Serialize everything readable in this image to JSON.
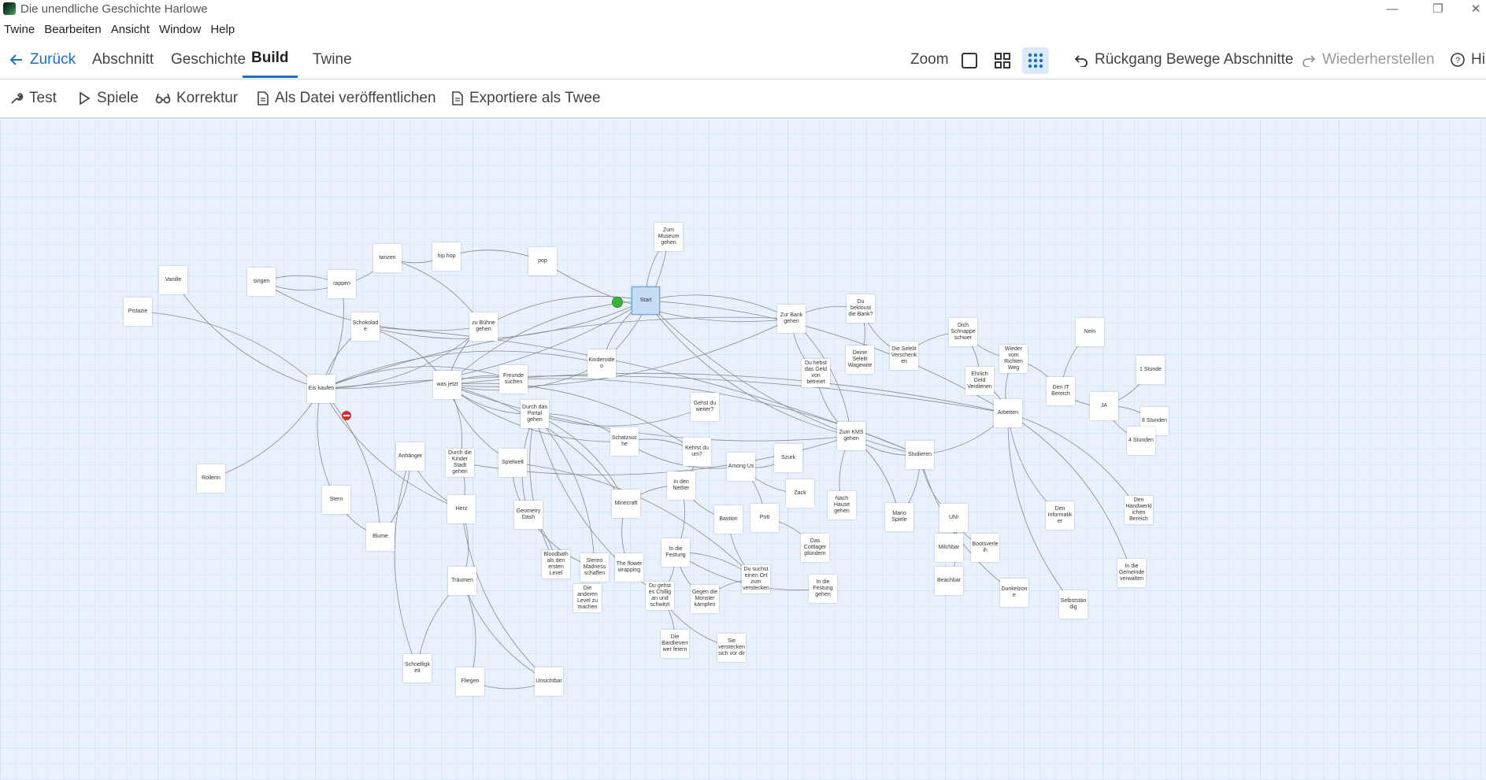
{
  "window": {
    "title": "Die unendliche Geschichte Harlowe"
  },
  "menu": [
    "Twine",
    "Bearbeiten",
    "Ansicht",
    "Window",
    "Help"
  ],
  "toolbar": {
    "back": "Zurück",
    "tabs": [
      "Abschnitt",
      "Geschichte",
      "Build",
      "Twine"
    ],
    "active_tab": "Build",
    "zoom_label": "Zoom",
    "undo": "Rückgang Bewege Abschnitte",
    "redo": "Wiederherstellen",
    "help": "Hil"
  },
  "build_toolbar": {
    "test": "Test",
    "play": "Spiele",
    "proof": "Korrektur",
    "publish": "Als Datei veröffentlichen",
    "export": "Exportiere als Twee"
  },
  "colors": {
    "accent": "#1a6fc7",
    "start": "#3cb43c",
    "broken": "#d32f2f"
  },
  "passages": [
    {
      "name": "Start"
    },
    {
      "name": "Zum Museum gehen"
    },
    {
      "name": "Vanille"
    },
    {
      "name": "Pistazie"
    },
    {
      "name": "singen"
    },
    {
      "name": "rappen"
    },
    {
      "name": "tanzen"
    },
    {
      "name": "hip hop"
    },
    {
      "name": "pop"
    },
    {
      "name": "Schokolade"
    },
    {
      "name": "zu Bühne gehen"
    },
    {
      "name": "Eis kaufen"
    },
    {
      "name": "was jetzt"
    },
    {
      "name": "Freunde suchen"
    },
    {
      "name": "Kindervideo"
    },
    {
      "name": "Zur Bank gehen"
    },
    {
      "name": "Du bekloust die Bank?"
    },
    {
      "name": "Deine Selelit Wagewite"
    },
    {
      "name": "Die Selelit Verschenken"
    },
    {
      "name": "Dich Schnappe schwer"
    },
    {
      "name": "Du hebst das Geld von betreiet"
    },
    {
      "name": "Ehrlich Geld Verdienen"
    },
    {
      "name": "Wieder vom Richten Weg"
    },
    {
      "name": "Nein"
    },
    {
      "name": "Den IT Bereich"
    },
    {
      "name": "1 Stunde"
    },
    {
      "name": "JA"
    },
    {
      "name": "8 Stunden"
    },
    {
      "name": "4 Stunden"
    },
    {
      "name": "Arbeiten"
    },
    {
      "name": "Durch das Portal gehen"
    },
    {
      "name": "Gehst du weiter?"
    },
    {
      "name": "Anhänger"
    },
    {
      "name": "Durch die Kinder Stadt gehen"
    },
    {
      "name": "Spielwelt"
    },
    {
      "name": "Schatzsuche"
    },
    {
      "name": "Kehrst du um?"
    },
    {
      "name": "Among Us"
    },
    {
      "name": "Szurk"
    },
    {
      "name": "Zum KMS gehen"
    },
    {
      "name": "Studieren"
    },
    {
      "name": "Rollerin"
    },
    {
      "name": "Stern"
    },
    {
      "name": "Herz"
    },
    {
      "name": "Blume"
    },
    {
      "name": "Geometry Dash"
    },
    {
      "name": "Minecraft"
    },
    {
      "name": "In den Nether"
    },
    {
      "name": "Zack"
    },
    {
      "name": "Nach Hause gehen"
    },
    {
      "name": "Mario Spiele"
    },
    {
      "name": "UNI"
    },
    {
      "name": "Den Informatiker"
    },
    {
      "name": "Den Handwerklichen Bereich"
    },
    {
      "name": "Bastion"
    },
    {
      "name": "Pott"
    },
    {
      "name": "Das Cottlager plündern"
    },
    {
      "name": "In die Festung"
    },
    {
      "name": "Bloodbath als den ersten Level"
    },
    {
      "name": "Stereo Madness schaffen"
    },
    {
      "name": "The flower wrapping"
    },
    {
      "name": "Du suchst einen Ort zum verstecken"
    },
    {
      "name": "In die Festung gehen"
    },
    {
      "name": "Milchbar"
    },
    {
      "name": "Bootsverleih"
    },
    {
      "name": "Beachbar"
    },
    {
      "name": "Dunkelzone"
    },
    {
      "name": "Selbstständig"
    },
    {
      "name": "In die Gemeinde verwalten"
    },
    {
      "name": "Träumen"
    },
    {
      "name": "Du gehst es Chillig an und schwitzt"
    },
    {
      "name": "Gegen die Monster kämpfen"
    },
    {
      "name": "Die anderen Level zu machen"
    },
    {
      "name": "Die Bardlieverr wer feiern"
    },
    {
      "name": "Sie verstecken sich vor dir"
    },
    {
      "name": "Schnelligkeit"
    },
    {
      "name": "Fliegen"
    },
    {
      "name": "Unsichtbar"
    }
  ]
}
